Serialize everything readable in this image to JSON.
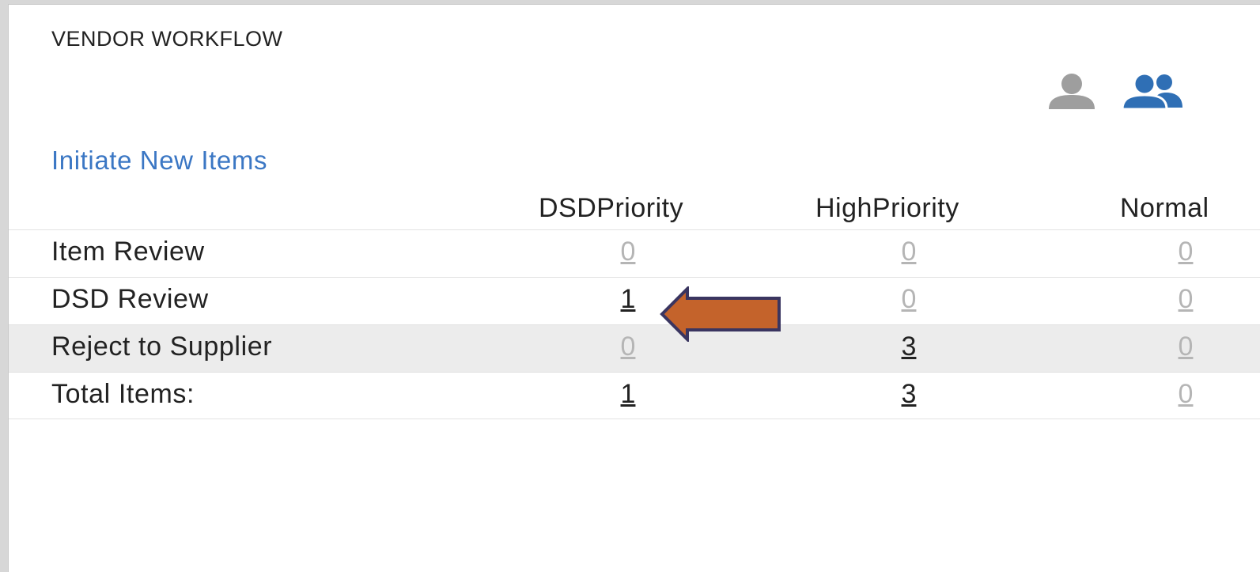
{
  "header": {
    "title": "VENDOR WORKFLOW",
    "icons": [
      "single-user-icon",
      "user-group-icon"
    ],
    "icon_colors": {
      "single": "#9e9e9e",
      "group": "#2f6fb5"
    }
  },
  "initiate_link": "Initiate New Items",
  "table": {
    "columns": [
      "DSDPriority",
      "HighPriority",
      "Normal"
    ],
    "rows": [
      {
        "label": "Item Review",
        "values": [
          "0",
          "0",
          "0"
        ]
      },
      {
        "label": "DSD Review",
        "values": [
          "1",
          "0",
          "0"
        ]
      },
      {
        "label": "Reject to Supplier",
        "values": [
          "0",
          "3",
          "0"
        ]
      },
      {
        "label": "Total Items:",
        "values": [
          "1",
          "3",
          "0"
        ]
      }
    ]
  },
  "annotation": {
    "type": "arrow-left",
    "color": "#c4632b",
    "outline": "#3a3560"
  }
}
